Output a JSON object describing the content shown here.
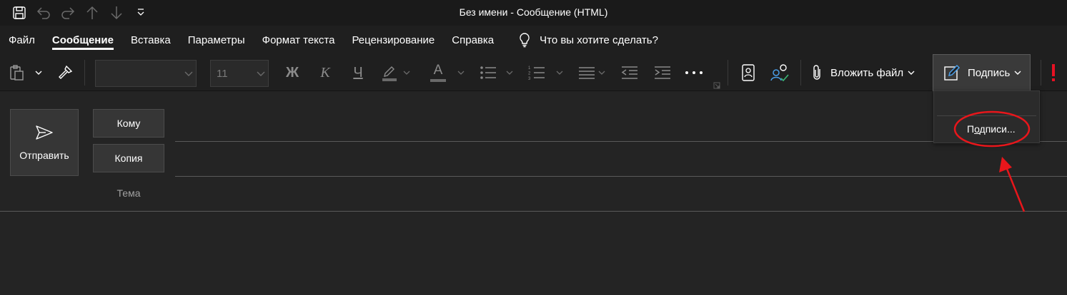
{
  "window": {
    "title": "Без имени  -  Сообщение (HTML)"
  },
  "quick_access": {
    "icons": [
      "save-icon",
      "undo-icon",
      "redo-icon",
      "arrow-up-icon",
      "arrow-down-icon",
      "customize-dropdown-icon"
    ]
  },
  "tabs": [
    {
      "label": "Файл",
      "active": false
    },
    {
      "label": "Сообщение",
      "active": true
    },
    {
      "label": "Вставка",
      "active": false
    },
    {
      "label": "Параметры",
      "active": false
    },
    {
      "label": "Формат текста",
      "active": false
    },
    {
      "label": "Рецензирование",
      "active": false
    },
    {
      "label": "Справка",
      "active": false
    }
  ],
  "tell_me": {
    "label": "Что вы хотите сделать?",
    "icon": "lightbulb-icon"
  },
  "ribbon": {
    "font_name": "",
    "font_size": "11",
    "bold_label": "Ж",
    "italic_label": "К",
    "underline_label": "Ч",
    "font_color_label": "А",
    "attach_label": "Вложить файл",
    "signature_label": "Подпись"
  },
  "signature_menu": {
    "item_prefix": "П",
    "item_accel": "о",
    "item_rest": "дписи..."
  },
  "compose": {
    "send_label": "Отправить",
    "to_label": "Кому",
    "cc_label": "Копия",
    "subject_label": "Тема"
  },
  "colors": {
    "background": "#242424",
    "ribbon": "#1f1f1f",
    "highlight_border": "#5a5a5a",
    "annotation_red": "#e8161b",
    "importance_red": "#e81123",
    "accent_blue": "#4a9ee8",
    "accent_green": "#3bb273"
  }
}
